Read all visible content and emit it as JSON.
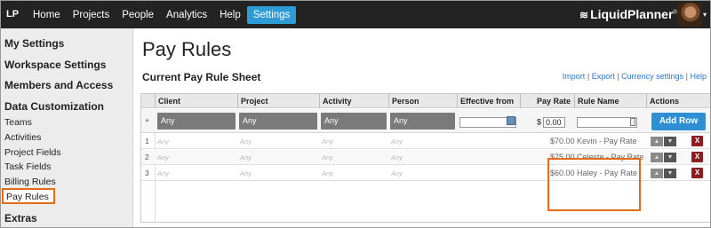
{
  "topnav": {
    "logo": "LP",
    "items": [
      {
        "label": "Home",
        "active": false
      },
      {
        "label": "Projects",
        "active": false
      },
      {
        "label": "People",
        "active": false
      },
      {
        "label": "Analytics",
        "active": false
      },
      {
        "label": "Help",
        "active": false
      },
      {
        "label": "Settings",
        "active": true
      }
    ],
    "brand": "LiquidPlanner",
    "brand_mark": "®",
    "brand_symbol": "≋",
    "caret": "▾"
  },
  "sidebar": {
    "sections": {
      "my_settings": "My Settings",
      "workspace_settings": "Workspace Settings",
      "members_access": "Members and Access",
      "data_customization": "Data Customization",
      "extras": "Extras"
    },
    "items": [
      "Teams",
      "Activities",
      "Project Fields",
      "Task Fields",
      "Billing Rules",
      "Pay Rules"
    ],
    "active_item": "Pay Rules"
  },
  "main": {
    "title": "Pay Rules",
    "sheet_title": "Current Pay Rule Sheet",
    "links": {
      "import": "Import",
      "export": "Export",
      "currency": "Currency settings",
      "help": "Help",
      "sep": "|"
    }
  },
  "table": {
    "columns": {
      "client": "Client",
      "project": "Project",
      "activity": "Activity",
      "person": "Person",
      "effective_from": "Effective from",
      "pay_rate": "Pay Rate",
      "rule_name": "Rule Name",
      "actions": "Actions"
    },
    "add_row": {
      "plus": "+",
      "client": "Any",
      "project": "Any",
      "activity": "Any",
      "person": "Any",
      "currency": "$",
      "rate_value": "0.00",
      "button": "Add Row"
    },
    "rows": [
      {
        "num": "1",
        "client": "Any",
        "project": "Any",
        "activity": "Any",
        "person": "Any",
        "rate": "$70.00",
        "name": "Kevin - Pay Rate"
      },
      {
        "num": "2",
        "client": "Any",
        "project": "Any",
        "activity": "Any",
        "person": "Any",
        "rate": "$75.00",
        "name": "Celeste - Pay Rate"
      },
      {
        "num": "3",
        "client": "Any",
        "project": "Any",
        "activity": "Any",
        "person": "Any",
        "rate": "$60.00",
        "name": "Haley - Pay Rate"
      }
    ],
    "actions": {
      "up": "▲",
      "down": "▼",
      "delete": "X"
    }
  },
  "colors": {
    "accent": "#2e9ad6",
    "highlight": "#e46a1c",
    "delete": "#8b1e1e"
  }
}
